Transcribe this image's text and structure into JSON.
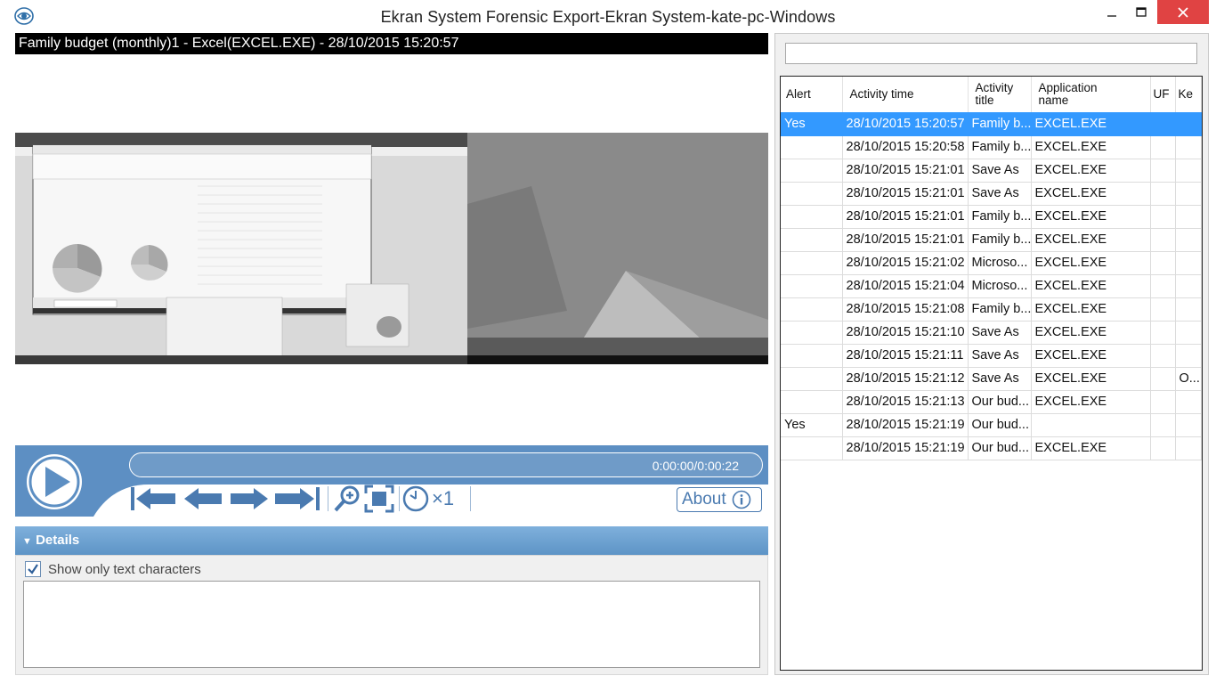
{
  "window": {
    "title": "Ekran System Forensic Export-Ekran System-kate-pc-Windows",
    "accent": "#4a7ab0",
    "close_color": "#e04343"
  },
  "player": {
    "caption": "Family budget (monthly)1 - Excel(EXCEL.EXE) - 28/10/2015 15:20:57",
    "time": "0:00:00/0:00:22",
    "speed": "×1",
    "about_label": "About",
    "progress": 0
  },
  "details": {
    "header": "Details",
    "show_only_text_label": "Show only text characters",
    "show_only_text_checked": true
  },
  "search": {
    "value": ""
  },
  "grid": {
    "columns": [
      "Alert",
      "Activity time",
      "Activity title",
      "Application name",
      "UF",
      "Ke"
    ],
    "rows": [
      {
        "alert": "Yes",
        "time": "28/10/2015 15:20:57",
        "title": "Family b...",
        "app": "EXCEL.EXE",
        "uf": "",
        "ke": "",
        "selected": true
      },
      {
        "alert": "",
        "time": "28/10/2015 15:20:58",
        "title": "Family b...",
        "app": "EXCEL.EXE",
        "uf": "",
        "ke": ""
      },
      {
        "alert": "",
        "time": "28/10/2015 15:21:01",
        "title": "Save As",
        "app": "EXCEL.EXE",
        "uf": "",
        "ke": ""
      },
      {
        "alert": "",
        "time": "28/10/2015 15:21:01",
        "title": "Save As",
        "app": "EXCEL.EXE",
        "uf": "",
        "ke": ""
      },
      {
        "alert": "",
        "time": "28/10/2015 15:21:01",
        "title": "Family b...",
        "app": "EXCEL.EXE",
        "uf": "",
        "ke": ""
      },
      {
        "alert": "",
        "time": "28/10/2015 15:21:01",
        "title": "Family b...",
        "app": "EXCEL.EXE",
        "uf": "",
        "ke": ""
      },
      {
        "alert": "",
        "time": "28/10/2015 15:21:02",
        "title": "Microso...",
        "app": "EXCEL.EXE",
        "uf": "",
        "ke": ""
      },
      {
        "alert": "",
        "time": "28/10/2015 15:21:04",
        "title": "Microso...",
        "app": "EXCEL.EXE",
        "uf": "",
        "ke": ""
      },
      {
        "alert": "",
        "time": "28/10/2015 15:21:08",
        "title": "Family b...",
        "app": "EXCEL.EXE",
        "uf": "",
        "ke": ""
      },
      {
        "alert": "",
        "time": "28/10/2015 15:21:10",
        "title": "Save As",
        "app": "EXCEL.EXE",
        "uf": "",
        "ke": ""
      },
      {
        "alert": "",
        "time": "28/10/2015 15:21:11",
        "title": "Save As",
        "app": "EXCEL.EXE",
        "uf": "",
        "ke": ""
      },
      {
        "alert": "",
        "time": "28/10/2015 15:21:12",
        "title": "Save As",
        "app": "EXCEL.EXE",
        "uf": "",
        "ke": "O..."
      },
      {
        "alert": "",
        "time": "28/10/2015 15:21:13",
        "title": "Our bud...",
        "app": "EXCEL.EXE",
        "uf": "",
        "ke": ""
      },
      {
        "alert": "Yes",
        "time": "28/10/2015 15:21:19",
        "title": "Our bud...",
        "app": "",
        "uf": "",
        "ke": ""
      },
      {
        "alert": "",
        "time": "28/10/2015 15:21:19",
        "title": "Our bud...",
        "app": "EXCEL.EXE",
        "uf": "",
        "ke": ""
      }
    ]
  }
}
